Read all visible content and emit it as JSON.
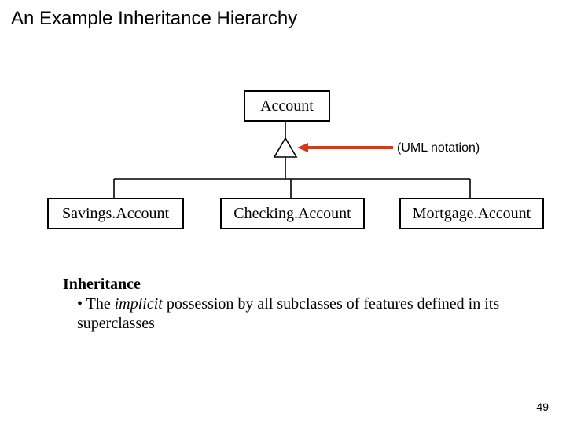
{
  "title": "An Example Inheritance Hierarchy",
  "uml": {
    "parent": "Account",
    "children": [
      "Savings.Account",
      "Checking.Account",
      "Mortgage.Account"
    ],
    "notation_label": "(UML notation)"
  },
  "body": {
    "term": "Inheritance",
    "bullet": "• ",
    "def_prefix": "The ",
    "def_italic": "implicit",
    "def_rest": " possession by all subclasses of features defined in its superclasses"
  },
  "page_number": "49",
  "colors": {
    "arrow": "#d23a1a"
  }
}
